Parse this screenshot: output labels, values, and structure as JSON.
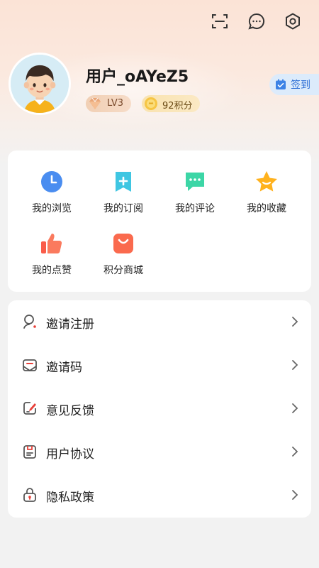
{
  "header": {
    "icons": [
      "scan-icon",
      "message-icon",
      "settings-icon"
    ]
  },
  "profile": {
    "username": "用户_oAYeZ5",
    "level": "LV3",
    "points": "92积分",
    "checkin_label": "签到"
  },
  "shortcuts": [
    {
      "label": "我的浏览",
      "icon": "clock-icon",
      "color": "#4a8df0"
    },
    {
      "label": "我的订阅",
      "icon": "bookmark-plus-icon",
      "color": "#3fc6e2"
    },
    {
      "label": "我的评论",
      "icon": "chat-bubble-icon",
      "color": "#3cd6a6"
    },
    {
      "label": "我的收藏",
      "icon": "star-icon",
      "color": "#ffb21e"
    },
    {
      "label": "我的点赞",
      "icon": "thumbs-up-icon",
      "color": "#fa5c4a"
    },
    {
      "label": "积分商城",
      "icon": "shopping-bag-icon",
      "color": "#fa6a4e"
    }
  ],
  "menu": [
    {
      "label": "邀请注册",
      "icon": "person-search-icon"
    },
    {
      "label": "邀请码",
      "icon": "envelope-icon"
    },
    {
      "label": "意见反馈",
      "icon": "feedback-edit-icon"
    },
    {
      "label": "用户协议",
      "icon": "clipboard-icon"
    },
    {
      "label": "隐私政策",
      "icon": "lock-icon"
    }
  ],
  "colors": {
    "accent_blue": "#2e6fd6",
    "accent_red": "#e8413a",
    "icon_gray": "#555555"
  }
}
